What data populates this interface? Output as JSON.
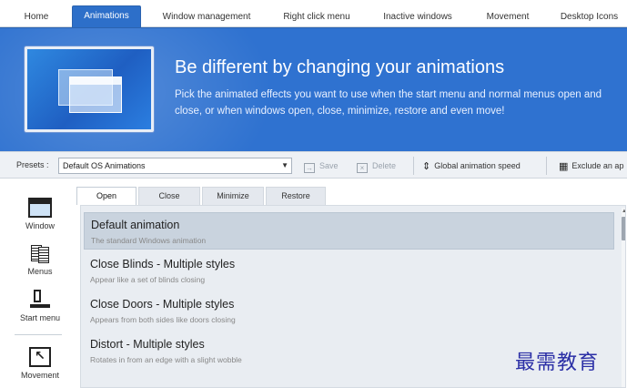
{
  "tabs": [
    {
      "label": "Home"
    },
    {
      "label": "Animations"
    },
    {
      "label": "Window management"
    },
    {
      "label": "Right click menu"
    },
    {
      "label": "Inactive windows"
    },
    {
      "label": "Movement"
    },
    {
      "label": "Desktop Icons"
    }
  ],
  "banner": {
    "title": "Be different by changing your animations",
    "description": "Pick the animated effects you want to use when the start menu and normal menus open and close, or when windows open, close, minimize, restore and even move!"
  },
  "toolbar": {
    "presets_label": "Presets :",
    "preset_value": "Default OS Animations",
    "save_label": "Save",
    "delete_label": "Delete",
    "speed_label": "Global animation speed",
    "exclude_label": "Exclude an ap"
  },
  "sidebar": {
    "items": [
      {
        "label": "Window",
        "icon": "window-icon"
      },
      {
        "label": "Menus",
        "icon": "menus-icon"
      },
      {
        "label": "Start menu",
        "icon": "start-menu-icon"
      },
      {
        "label": "Movement",
        "icon": "movement-icon"
      }
    ]
  },
  "subtabs": [
    {
      "label": "Open"
    },
    {
      "label": "Close"
    },
    {
      "label": "Minimize"
    },
    {
      "label": "Restore"
    }
  ],
  "animations": [
    {
      "name": "Default animation",
      "description": "The standard Windows animation"
    },
    {
      "name": "Close Blinds - Multiple styles",
      "description": "Appear like a set of blinds closing"
    },
    {
      "name": "Close Doors - Multiple styles",
      "description": "Appears from both sides like doors closing"
    },
    {
      "name": "Distort - Multiple styles",
      "description": "Rotates in from an edge with a slight wobble"
    }
  ],
  "watermark": "最需教育",
  "colors": {
    "accent": "#2d6fc9",
    "banner": "#2f72d0",
    "selected_row": "#c9d3de"
  }
}
